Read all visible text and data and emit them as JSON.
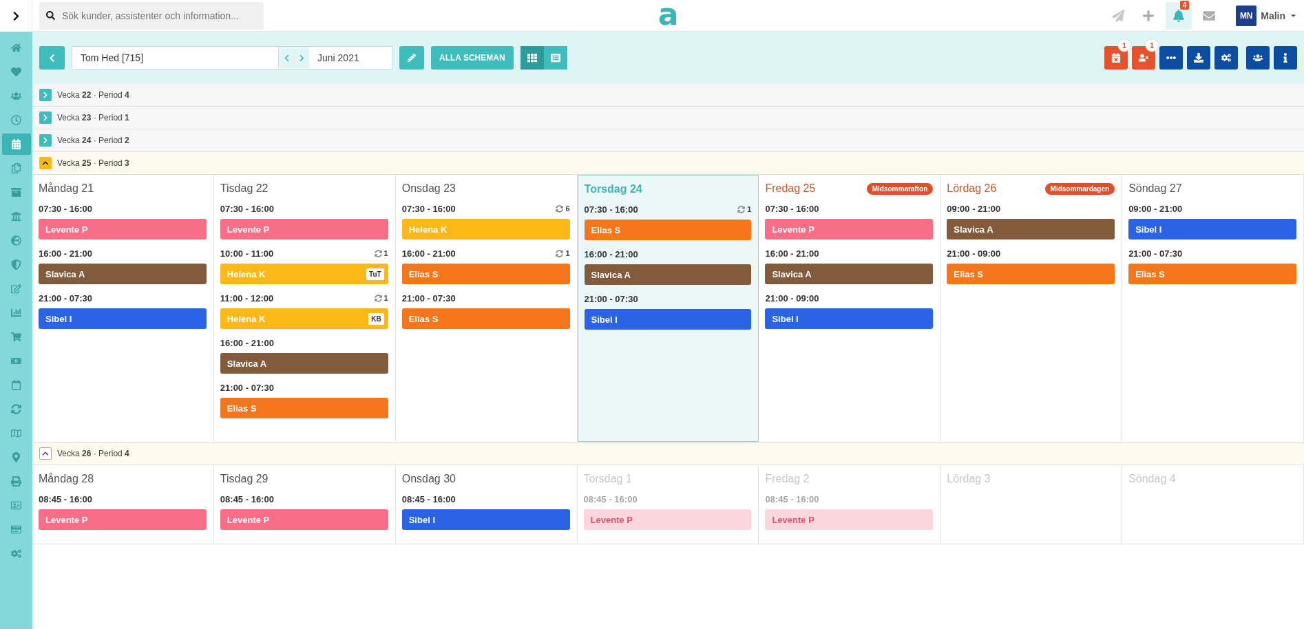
{
  "top_bar": {
    "search": {
      "placeholder": "Sök kunder, assistenter och information..."
    },
    "logo": "a",
    "actions": [
      {
        "selected": false,
        "disabled": true
      },
      {
        "selected": false,
        "disabled": false
      },
      {
        "selected": true,
        "disabled": false,
        "badge": "4"
      },
      {
        "selected": false,
        "disabled": false
      }
    ],
    "user": {
      "initials": "MN",
      "name": "Malin"
    }
  },
  "sidebar": {
    "items": [
      {
        "selected": false
      },
      {
        "selected": false
      },
      {
        "selected": false
      },
      {
        "selected": false
      },
      {
        "selected": true
      },
      {
        "selected": false
      },
      {
        "selected": false
      },
      {
        "selected": false
      },
      {
        "selected": false
      },
      {
        "selected": false
      },
      {
        "selected": false
      },
      {
        "selected": false
      },
      {
        "selected": false
      },
      {
        "selected": false
      },
      {
        "selected": false
      },
      {
        "selected": false
      },
      {
        "selected": false
      },
      {
        "selected": false
      },
      {
        "selected": false
      },
      {
        "selected": false
      },
      {
        "selected": false
      },
      {
        "selected": false
      }
    ]
  },
  "toolbar": {
    "customer": "Tom Hed [715]",
    "month": "Juni 2021",
    "all_schedules": "ALLA SCHEMAN",
    "views": [
      {
        "selected": true
      },
      {
        "selected": false
      }
    ],
    "buttons": [
      {
        "kind": "alert",
        "badge": "1"
      },
      {
        "kind": "alert",
        "badge": "1"
      },
      {
        "kind": "action"
      },
      {
        "kind": "action"
      },
      {
        "kind": "action"
      },
      {
        "kind": "action"
      },
      {
        "kind": "action"
      }
    ]
  },
  "weeks": [
    {
      "label": "Vecka **22** · Period **4**",
      "expanded": false,
      "current": false
    },
    {
      "label": "Vecka **23** · Period **1**",
      "expanded": false,
      "current": false
    },
    {
      "label": "Vecka **24** · Period **2**",
      "expanded": false,
      "current": false
    },
    {
      "label": "Vecka **25** · Period **3**",
      "expanded": true,
      "current": true,
      "days": [
        {
          "name": "Måndag 21",
          "kind": "normal",
          "shifts": [
            {
              "time": "07:30 - 16:00",
              "person": "Levente P",
              "color": "#f76e86"
            },
            {
              "time": "16:00 - 21:00",
              "person": "Slavica A",
              "color": "#825a3c"
            },
            {
              "time": "21:00 - 07:30",
              "person": "Sibel I",
              "color": "#2b63e6"
            }
          ]
        },
        {
          "name": "Tisdag 22",
          "kind": "normal",
          "shifts": [
            {
              "time": "07:30 - 16:00",
              "person": "Levente P",
              "color": "#f76e86"
            },
            {
              "time": "10:00 - 11:00",
              "sync": "1",
              "person": "Helena K",
              "tag": "TuT",
              "color": "#fbb817"
            },
            {
              "time": "11:00 - 12:00",
              "sync": "1",
              "person": "Helena K",
              "tag": "KB",
              "color": "#fbb817"
            },
            {
              "time": "16:00 - 21:00",
              "person": "Slavica A",
              "color": "#825a3c"
            },
            {
              "time": "21:00 - 07:30",
              "person": "Elias S",
              "color": "#f5761b"
            }
          ]
        },
        {
          "name": "Onsdag 23",
          "kind": "normal",
          "shifts": [
            {
              "time": "07:30 - 16:00",
              "sync": "6",
              "person": "Helena K",
              "color": "#fbb817"
            },
            {
              "time": "16:00 - 21:00",
              "sync": "1",
              "person": "Elias S",
              "color": "#f5761b"
            },
            {
              "time": "21:00 - 07:30",
              "person": "Elias S",
              "color": "#f5761b"
            }
          ]
        },
        {
          "name": "Torsdag 24",
          "kind": "today",
          "shifts": [
            {
              "time": "07:30 - 16:00",
              "sync": "1",
              "person": "Elias S",
              "color": "#f5761b"
            },
            {
              "time": "16:00 - 21:00",
              "person": "Slavica A",
              "color": "#825a3c"
            },
            {
              "time": "21:00 - 07:30",
              "person": "Sibel I",
              "color": "#2b63e6"
            }
          ]
        },
        {
          "name": "Fredag 25",
          "kind": "holiday",
          "holiday": "Midsommarafton",
          "shifts": [
            {
              "time": "07:30 - 16:00",
              "person": "Levente P",
              "color": "#f76e86"
            },
            {
              "time": "16:00 - 21:00",
              "person": "Slavica A",
              "color": "#825a3c"
            },
            {
              "time": "21:00 - 09:00",
              "person": "Sibel I",
              "color": "#2b63e6"
            }
          ]
        },
        {
          "name": "Lördag 26",
          "kind": "holiday",
          "holiday": "Midsommardagen",
          "shifts": [
            {
              "time": "09:00 - 21:00",
              "person": "Slavica A",
              "color": "#825a3c"
            },
            {
              "time": "21:00 - 09:00",
              "person": "Elias S",
              "color": "#f5761b"
            }
          ]
        },
        {
          "name": "Söndag 27",
          "kind": "normal",
          "shifts": [
            {
              "time": "09:00 - 21:00",
              "person": "Sibel I",
              "color": "#2b63e6"
            },
            {
              "time": "21:00 - 07:30",
              "person": "Elias S",
              "color": "#f5761b"
            }
          ]
        }
      ]
    },
    {
      "label": "Vecka **26** · Period **4**",
      "expanded": true,
      "current": false,
      "days": [
        {
          "name": "Måndag 28",
          "kind": "normal",
          "shifts": [
            {
              "time": "08:45 - 16:00",
              "person": "Levente P",
              "color": "#f76e86"
            }
          ]
        },
        {
          "name": "Tisdag 29",
          "kind": "normal",
          "shifts": [
            {
              "time": "08:45 - 16:00",
              "person": "Levente P",
              "color": "#f76e86"
            }
          ]
        },
        {
          "name": "Onsdag 30",
          "kind": "normal",
          "shifts": [
            {
              "time": "08:45 - 16:00",
              "person": "Sibel I",
              "color": "#2b63e6"
            }
          ]
        },
        {
          "name": "Torsdag 1",
          "kind": "other_month",
          "shifts": [
            {
              "time": "08:45 - 16:00",
              "person": "Levente P",
              "color": "#fcd6dd"
            }
          ]
        },
        {
          "name": "Fredag 2",
          "kind": "other_month",
          "shifts": [
            {
              "time": "08:45 - 16:00",
              "person": "Levente P",
              "color": "#fcd6dd"
            }
          ]
        },
        {
          "name": "Lördag 3",
          "kind": "other_month"
        },
        {
          "name": "Söndag 4",
          "kind": "other_month"
        }
      ]
    }
  ]
}
